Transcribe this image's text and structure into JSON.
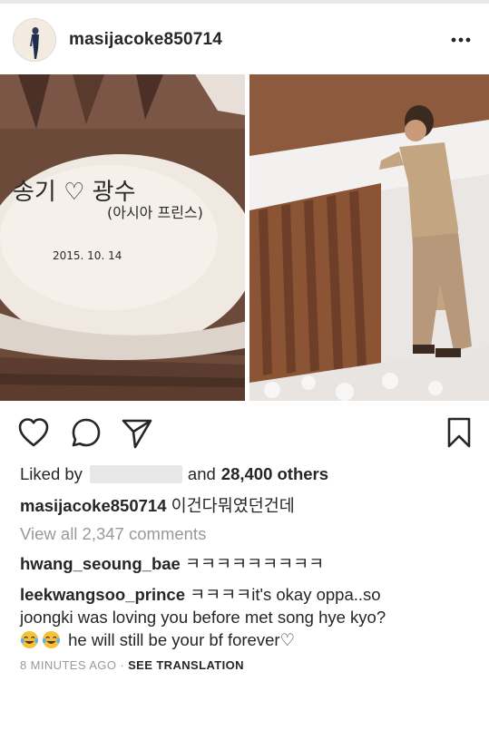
{
  "post": {
    "username": "masijacoke850714",
    "more_icon": "more-horizontal-icon"
  },
  "actions": {
    "like_icon": "heart-icon",
    "comment_icon": "comment-icon",
    "share_icon": "send-icon",
    "save_icon": "bookmark-icon"
  },
  "likes": {
    "prefix": "Liked by",
    "middle": "and",
    "count": "28,400 others"
  },
  "caption": {
    "username": "masijacoke850714",
    "text": "이건다뭐였던건데"
  },
  "view_all": "View all 2,347 comments",
  "comments": [
    {
      "username": "hwang_seoung_bae",
      "text": "ㅋㅋㅋㅋㅋㅋㅋㅋㅋ"
    },
    {
      "username": "leekwangsoo_prince",
      "text_line1": "ㅋㅋㅋㅋit's okay oppa..so",
      "text_line2": "joongki was loving you before met song hye kyo?",
      "text_line3": "he will still be your bf forever♡",
      "emoji_icon": "face-with-tears-of-joy-icon"
    }
  ],
  "meta": {
    "time": "8 MINUTES AGO",
    "separator": "·",
    "translate": "SEE TRANSLATION"
  },
  "photo_left": {
    "stone_line1": "송기 ♡ 광수",
    "stone_line2": "(아시아 프린스)",
    "stone_date": "2015. 10. 14"
  },
  "colors": {
    "text": "#262626",
    "muted": "#999999"
  }
}
